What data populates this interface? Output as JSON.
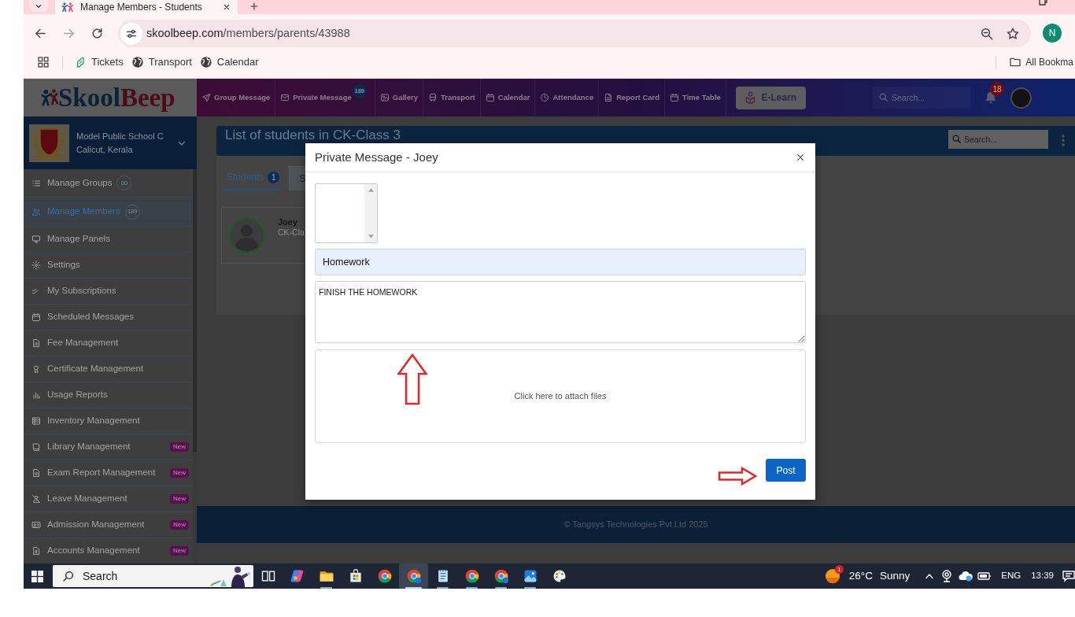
{
  "browser": {
    "tab": {
      "title": "Manage Members - Students"
    },
    "address": {
      "domain": "skoolbeep.com",
      "path": "/members/parents/43988"
    },
    "profile": {
      "initial": "N"
    },
    "bookmarks": [
      {
        "label": "Tickets",
        "kind": "tickets"
      },
      {
        "label": "Transport",
        "kind": "globe"
      },
      {
        "label": "Calendar",
        "kind": "globe"
      }
    ],
    "all_bookmarks": {
      "label": "All Bookma"
    }
  },
  "header": {
    "logo": {
      "part_1": "Skool",
      "part_2": "Beep"
    },
    "nav": [
      {
        "label": "Group Message",
        "kind": "send"
      },
      {
        "label": "Private Message",
        "kind": "mail",
        "badge": "189"
      },
      {
        "label": "Gallery",
        "kind": "image"
      },
      {
        "label": "Transport",
        "kind": "bus"
      },
      {
        "label": "Calendar",
        "kind": "calendar"
      },
      {
        "label": "Attendance",
        "kind": "clock"
      },
      {
        "label": "Report Card",
        "kind": "doc"
      },
      {
        "label": "Time Table",
        "kind": "calendar"
      }
    ],
    "elearn": {
      "label": "E-Learn"
    },
    "search": {
      "placeholder": "Search..."
    },
    "notifications": {
      "badge": "18"
    }
  },
  "sidebar": {
    "school": {
      "name": "Model Public School C",
      "place": "Calicut, Kerala"
    },
    "items": [
      {
        "label": "Manage Groups",
        "kind": "list",
        "count": "60",
        "selected": false
      },
      {
        "label": "Manage Members",
        "kind": "users",
        "count": "189",
        "selected": true
      },
      {
        "label": "Manage Panels",
        "kind": "monitor",
        "selected": false
      },
      {
        "label": "Settings",
        "kind": "gear",
        "selected": false
      },
      {
        "label": "My Subscriptions",
        "kind": "checks",
        "selected": false
      },
      {
        "label": "Scheduled Messages",
        "kind": "calendar",
        "selected": false
      },
      {
        "label": "Fee Management",
        "kind": "file",
        "selected": false
      },
      {
        "label": "Certificate Management",
        "kind": "award",
        "selected": false
      },
      {
        "label": "Usage Reports",
        "kind": "bars",
        "selected": false
      },
      {
        "label": "Inventory Management",
        "kind": "table",
        "selected": false
      },
      {
        "label": "Library Management",
        "kind": "book",
        "tag": "New",
        "selected": false
      },
      {
        "label": "Exam Report Management",
        "kind": "file",
        "tag": "New",
        "selected": false
      },
      {
        "label": "Leave Management",
        "kind": "user_off",
        "tag": "New",
        "selected": false
      },
      {
        "label": "Admission Management",
        "kind": "idcard",
        "tag": "New",
        "selected": false
      },
      {
        "label": "Accounts Management",
        "kind": "file_money",
        "tag": "New",
        "selected": false
      }
    ]
  },
  "main": {
    "title": "List of students in CK-Class 3",
    "search": {
      "placeholder": "Search..."
    },
    "tabs": [
      {
        "label": "Students",
        "count": "1",
        "selected": true
      },
      {
        "label": "S",
        "selected": false
      }
    ],
    "students": [
      {
        "name": "Joey",
        "class": "CK-Cla"
      }
    ]
  },
  "modal": {
    "title": "Private Message - Joey",
    "subject": "Homework",
    "message": "FINISH THE HOMEWORK",
    "attach": "Click here to attach files",
    "button": "Post"
  },
  "footer": {
    "text": "© Tangsys Technologies Pvt Ltd 2025"
  },
  "taskbar": {
    "search": {
      "placeholder": "Search"
    },
    "apps": [
      {
        "kind": "taskview",
        "open": false,
        "selected": false
      },
      {
        "kind": "copilot",
        "open": false,
        "selected": false
      },
      {
        "kind": "explorer",
        "open": true,
        "selected": false
      },
      {
        "kind": "store",
        "open": false,
        "selected": false
      },
      {
        "kind": "chrome",
        "open": false,
        "selected": false
      },
      {
        "kind": "chrome_alt",
        "open": true,
        "selected": true
      },
      {
        "kind": "notepad",
        "open": true,
        "selected": false
      },
      {
        "kind": "chrome",
        "open": true,
        "selected": false
      },
      {
        "kind": "chrome_alt",
        "open": true,
        "selected": false
      },
      {
        "kind": "photos",
        "open": true,
        "selected": false
      },
      {
        "kind": "paint",
        "open": false,
        "selected": false
      }
    ],
    "weather": {
      "badge": "1",
      "temperature": "26°C",
      "condition": "Sunny"
    },
    "language": "ENG",
    "time": "13:39"
  }
}
